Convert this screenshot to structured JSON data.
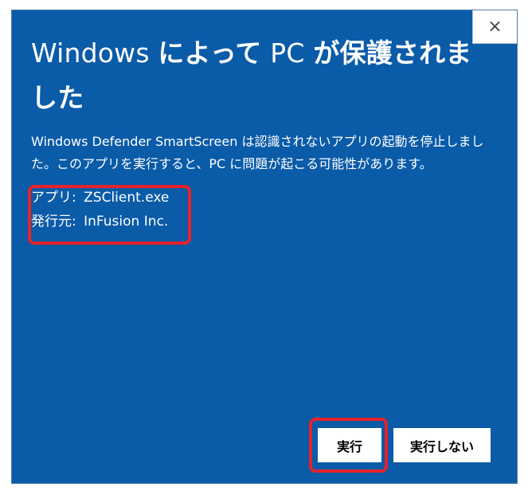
{
  "dialog": {
    "title_prefix": "Windows ",
    "title_emph_1": "によって",
    "title_middle": " PC ",
    "title_emph_2": "が保護されました",
    "description": "Windows Defender SmartScreen は認識されないアプリの起動を停止しました。このアプリを実行すると、PC に問題が起こる可能性があります。",
    "app_label": "アプリ:",
    "app_value": "ZSClient.exe",
    "publisher_label": "発行元:",
    "publisher_value": "InFusion Inc.",
    "close_glyph": "×"
  },
  "buttons": {
    "run_label": "実行",
    "dont_run_label": "実行しない"
  },
  "colors": {
    "dialog_background": "#0a5ba8",
    "highlight": "#e6222b",
    "button_background": "#ffffff"
  }
}
